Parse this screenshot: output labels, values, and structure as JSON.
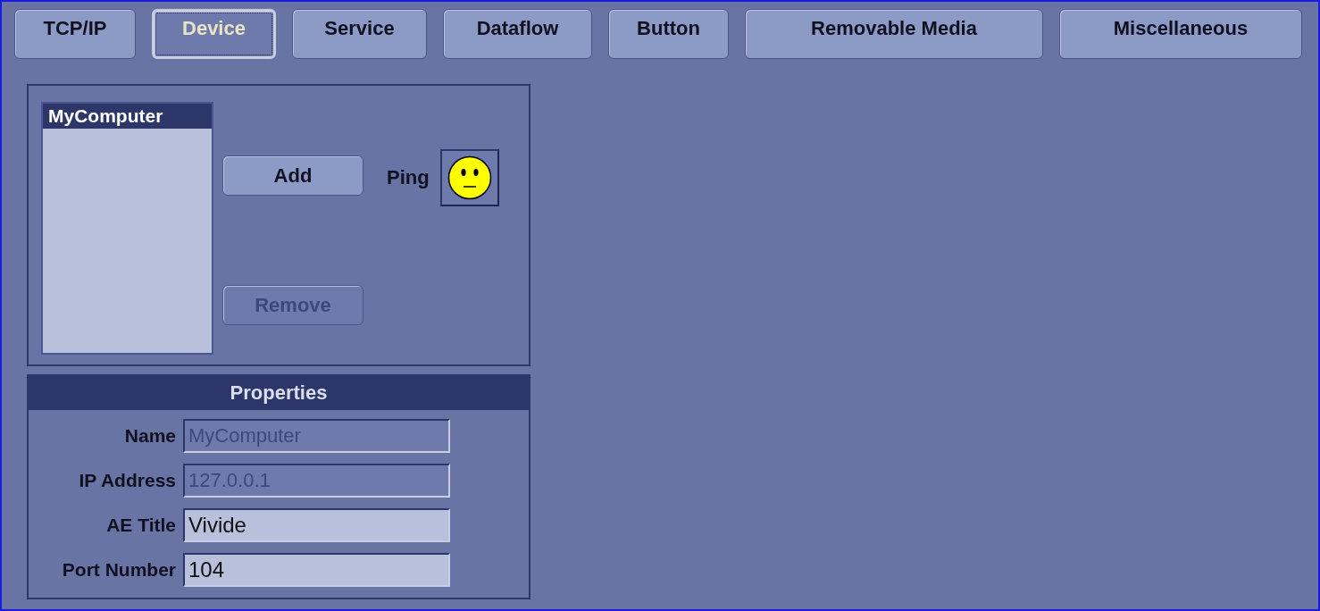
{
  "tabs": [
    {
      "label": "TCP/IP",
      "selected": false
    },
    {
      "label": "Device",
      "selected": true
    },
    {
      "label": "Service",
      "selected": false
    },
    {
      "label": "Dataflow",
      "selected": false
    },
    {
      "label": "Button",
      "selected": false
    },
    {
      "label": "Removable Media",
      "selected": false
    },
    {
      "label": "Miscellaneous",
      "selected": false
    }
  ],
  "device_list": {
    "items": [
      {
        "label": "MyComputer",
        "selected": true
      }
    ]
  },
  "buttons": [
    {
      "label": "Add",
      "disabled": false
    },
    {
      "label": "Remove",
      "disabled": true
    }
  ],
  "ping": {
    "label": "Ping"
  },
  "properties": {
    "title": "Properties",
    "fields": [
      {
        "label": "Name",
        "value": "MyComputer",
        "disabled": true
      },
      {
        "label": "IP Address",
        "value": "127.0.0.1",
        "disabled": true
      },
      {
        "label": "AE Title",
        "value": "Vivide",
        "disabled": false
      },
      {
        "label": "Port Number",
        "value": "104",
        "disabled": false
      }
    ]
  }
}
